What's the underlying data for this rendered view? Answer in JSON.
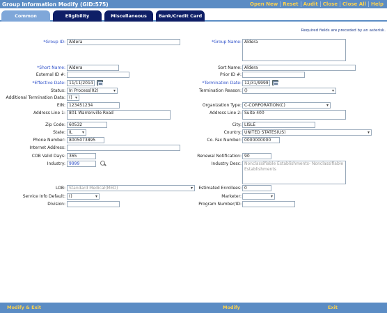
{
  "window": {
    "title": "Group Information Modify (GID:575)"
  },
  "top_links": [
    "Open New",
    "Reset",
    "Audit",
    "Close",
    "Close All",
    "Help"
  ],
  "tabs": [
    "Common",
    "Eligibility",
    "Miscellaneous",
    "Bank/Credit Card Info"
  ],
  "required_note": "Required fields are preceded by an asterisk.",
  "form": {
    "group_id": {
      "label": "*Group ID:",
      "value": "Aldera"
    },
    "group_name": {
      "label": "*Group Name:",
      "value": "Aldera"
    },
    "short_name": {
      "label": "*Short Name:",
      "value": "Aldera"
    },
    "sort_name": {
      "label": "Sort Name:",
      "value": "Aldera"
    },
    "external_id": {
      "label": "External ID #:",
      "value": ""
    },
    "prior_id": {
      "label": "Prior ID #:",
      "value": ""
    },
    "effective_date": {
      "label": "*Effective Date:",
      "value": "11/11/2014"
    },
    "termination_date": {
      "label": "*Termination Date:",
      "value": "12/31/9999"
    },
    "status": {
      "label": "Status:",
      "value": "In Process(02)"
    },
    "termination_reason": {
      "label": "Termination Reason:",
      "value": "()"
    },
    "additional_termination_data": {
      "label": "Additional Termination Data:",
      "value": "()"
    },
    "ein": {
      "label": "EIN:",
      "value": "123451234"
    },
    "organization_type": {
      "label": "Organization Type:",
      "value": "C-CORPORATION(C)"
    },
    "address_line_1": {
      "label": "Address Line 1:",
      "value": "801 Warrenville Road"
    },
    "address_line_2": {
      "label": "Address Line 2:",
      "value": "Suite 400"
    },
    "zip_code": {
      "label": "Zip Code:",
      "value": "60532"
    },
    "city": {
      "label": "City:",
      "value": "LISLE"
    },
    "state": {
      "label": "State:",
      "value": "IL"
    },
    "country": {
      "label": "Country:",
      "value": "UNITED STATES(US)"
    },
    "phone_number": {
      "label": "Phone Number:",
      "value": "8005073895"
    },
    "fax_number": {
      "label": "Co. Fax Number:",
      "value": "0000000000"
    },
    "internet_address": {
      "label": "Internet Address:",
      "value": ""
    },
    "cob_valid_days": {
      "label": "COB Valid Days:",
      "value": "365"
    },
    "renewal_notification": {
      "label": "Renewal Notification:",
      "value": "90"
    },
    "industry": {
      "label": "Industry:",
      "value": "9999"
    },
    "industry_desc": {
      "label": "Industry Desc:",
      "value": "Nonclassifiable Establishments- Nonclassifiable Establishments"
    },
    "lob": {
      "label": "LOB:",
      "value": "Standard Medical(MED)"
    },
    "estimated_enrollees": {
      "label": "Estimated Enrollees:",
      "value": "0"
    },
    "service_info_default": {
      "label": "Service Info Default:",
      "value": "()"
    },
    "marketer": {
      "label": "Marketer:",
      "value": ""
    },
    "division": {
      "label": "Division:",
      "value": ""
    },
    "program_number": {
      "label": "Program Number/ID:",
      "value": ""
    }
  },
  "footer": {
    "modify_exit": "Modify & Exit",
    "modify": "Modify",
    "exit": "Exit"
  }
}
